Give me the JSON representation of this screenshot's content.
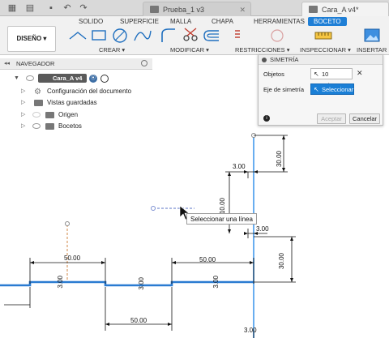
{
  "topbar": {
    "tab_inactive": "Prueba_1 v3",
    "tab_active": "Cara_A v4*"
  },
  "ribbon": {
    "tabs": [
      "SOLIDO",
      "SUPERFICIE",
      "MALLA",
      "CHAPA",
      "HERRAMIENTAS",
      "BOCETO"
    ],
    "active_tab": "BOCETO",
    "design_button": "DISEÑO",
    "groups": {
      "create": "CREAR",
      "modify": "MODIFICAR",
      "constraints": "RESTRICCIONES",
      "inspect": "INSPECCIONAR",
      "insert": "INSERTAR"
    }
  },
  "navigator": {
    "title": "NAVEGADOR",
    "root": "Cara_A v4",
    "items": [
      {
        "label": "Configuración del documento",
        "icon": "gear-icon"
      },
      {
        "label": "Vistas guardadas",
        "icon": "folder-icon"
      },
      {
        "label": "Origen",
        "icon": "folder-icon"
      },
      {
        "label": "Bocetos",
        "icon": "folder-icon"
      }
    ]
  },
  "symmetry_dialog": {
    "title": "SIMETRÍA",
    "objects_label": "Objetos",
    "objects_value": "10 selecc...",
    "axis_label": "Eje de simetría",
    "axis_value": "Seleccionar",
    "accept": "Aceptar",
    "cancel": "Cancelar"
  },
  "canvas": {
    "tooltip": "Seleccionar una línea",
    "dimensions": {
      "top_right_horizontal": "3.00",
      "top_right_vertical": "30.00",
      "middle_vertical": "10.00",
      "middle_horizontal": "3.00",
      "lower_right_vertical": "30.00",
      "left_top": "50.00",
      "right_top": "50.00",
      "bottom_middle": "50.00",
      "notch_1": "3.00",
      "notch_2": "3.00",
      "notch_3": "3.00",
      "bottom_right": "3.00"
    }
  },
  "colors": {
    "accent": "#1f7fd6",
    "profile_line": "#2a7bd1",
    "construction_line": "#d08a4a"
  }
}
